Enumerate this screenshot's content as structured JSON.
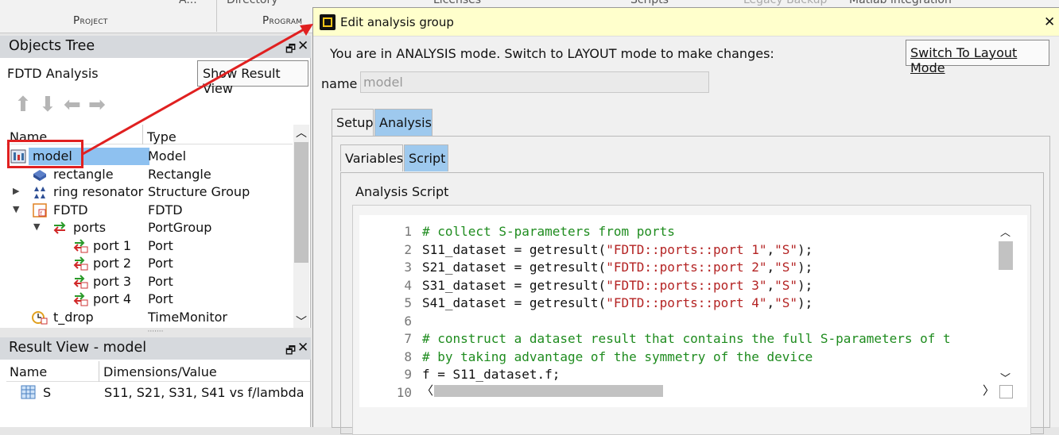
{
  "ribbon": {
    "top_items": [
      "A...",
      "Directory",
      "Licenses",
      "Scripts",
      "Legacy Backup",
      "Matlab integration"
    ],
    "sections": [
      "Project",
      "Program"
    ]
  },
  "objects_tree": {
    "title": "Objects Tree",
    "subtitle": "FDTD Analysis",
    "show_result_btn": "Show Result View",
    "col_name": "Name",
    "col_type": "Type",
    "rows": [
      {
        "name": "model",
        "type": "Model"
      },
      {
        "name": "rectangle",
        "type": "Rectangle"
      },
      {
        "name": "ring resonator",
        "type": "Structure Group"
      },
      {
        "name": "FDTD",
        "type": "FDTD"
      },
      {
        "name": "ports",
        "type": "PortGroup"
      },
      {
        "name": "port 1",
        "type": "Port"
      },
      {
        "name": "port 2",
        "type": "Port"
      },
      {
        "name": "port 3",
        "type": "Port"
      },
      {
        "name": "port 4",
        "type": "Port"
      },
      {
        "name": "t_drop",
        "type": "TimeMonitor"
      }
    ]
  },
  "result_view": {
    "title": "Result View - model",
    "col_name": "Name",
    "col_dims": "Dimensions/Value",
    "rows": [
      {
        "name": "S",
        "value": "S11, S21, S31, S41 vs f/lambda"
      }
    ]
  },
  "dialog": {
    "title": "Edit analysis group",
    "mode_text": "You are in ANALYSIS mode.  Switch to LAYOUT mode to make changes:",
    "switch_btn": "Switch To Layout Mode",
    "name_label": "name",
    "name_value": "model",
    "outer_tabs": [
      "Setup",
      "Analysis"
    ],
    "inner_tabs": [
      "Variables",
      "Script"
    ],
    "script_label": "Analysis Script",
    "code_lines": [
      "# collect S-parameters from ports",
      "S11_dataset = getresult(\"FDTD::ports::port 1\",\"S\");",
      "S21_dataset = getresult(\"FDTD::ports::port 2\",\"S\");",
      "S31_dataset = getresult(\"FDTD::ports::port 3\",\"S\");",
      "S41_dataset = getresult(\"FDTD::ports::port 4\",\"S\");",
      "",
      "# construct a dataset result that contains the full S-parameters of t",
      "# by taking advantage of the symmetry of the device",
      "f = S11_dataset.f;",
      ""
    ]
  },
  "colors": {
    "annotation": "#e02020",
    "selection": "#8ec1f0",
    "dialog_title_bg": "#ffffcc",
    "comment": "#1f8c1f",
    "string": "#b42323"
  }
}
